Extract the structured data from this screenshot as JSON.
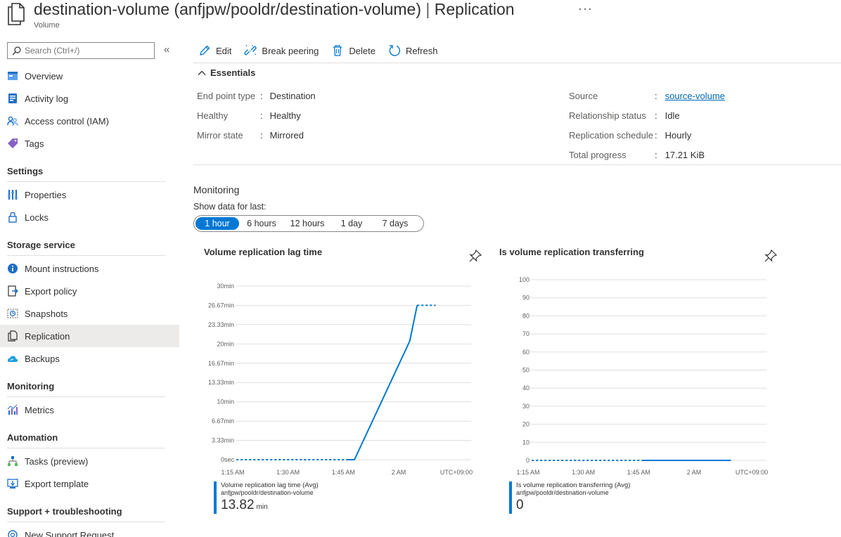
{
  "header": {
    "title": "destination-volume (anfjpw/pooldr/destination-volume)",
    "separator": "|",
    "section": "Replication",
    "more": "···",
    "subtitle": "Volume"
  },
  "sidebar": {
    "search_placeholder": "Search (Ctrl+/)",
    "collapse": "«",
    "items": [
      {
        "label": "Overview"
      },
      {
        "label": "Activity log"
      },
      {
        "label": "Access control (IAM)"
      },
      {
        "label": "Tags"
      }
    ],
    "sections": [
      {
        "title": "Settings",
        "items": [
          {
            "label": "Properties"
          },
          {
            "label": "Locks"
          }
        ]
      },
      {
        "title": "Storage service",
        "items": [
          {
            "label": "Mount instructions"
          },
          {
            "label": "Export policy"
          },
          {
            "label": "Snapshots"
          },
          {
            "label": "Replication"
          },
          {
            "label": "Backups"
          }
        ]
      },
      {
        "title": "Monitoring",
        "items": [
          {
            "label": "Metrics"
          }
        ]
      },
      {
        "title": "Automation",
        "items": [
          {
            "label": "Tasks (preview)"
          },
          {
            "label": "Export template"
          }
        ]
      },
      {
        "title": "Support + troubleshooting",
        "items": [
          {
            "label": "New Support Request"
          }
        ]
      }
    ],
    "active": "Replication"
  },
  "toolbar": {
    "edit": "Edit",
    "break_peering": "Break peering",
    "delete": "Delete",
    "refresh": "Refresh"
  },
  "essentials": {
    "title": "Essentials",
    "left": [
      {
        "key": "End point type",
        "value": "Destination"
      },
      {
        "key": "Healthy",
        "value": "Healthy"
      },
      {
        "key": "Mirror state",
        "value": "Mirrored"
      }
    ],
    "right": [
      {
        "key": "Source",
        "value": "source-volume"
      },
      {
        "key": "Relationship status",
        "value": "Idle"
      },
      {
        "key": "Replication schedule",
        "value": "Hourly"
      },
      {
        "key": "Total progress",
        "value": "17.21 KiB"
      }
    ]
  },
  "monitoring": {
    "title": "Monitoring",
    "show_label": "Show data for last:",
    "ranges": [
      "1 hour",
      "6 hours",
      "12 hours",
      "1 day",
      "7 days"
    ],
    "selected_range": "1 hour"
  },
  "chart_data": [
    {
      "type": "line",
      "title": "Volume replication lag time",
      "y_ticks": [
        "0sec",
        "3.33min",
        "6.67min",
        "10min",
        "13.33min",
        "16.67min",
        "20min",
        "23.33min",
        "26.67min",
        "30min"
      ],
      "ylim": [
        0,
        30
      ],
      "y_unit": "min",
      "x_ticks": [
        "1:15 AM",
        "1:30 AM",
        "1:45 AM",
        "2 AM",
        "UTC+09:00"
      ],
      "x": [
        "1:16 AM",
        "1:46 AM",
        "1:48 AM",
        "2:03 AM",
        "2:05 AM",
        "2:08 AM",
        "2:10 AM"
      ],
      "series": [
        {
          "values": [
            0,
            0,
            0,
            20.5,
            26.67,
            26.67,
            26.67
          ]
        }
      ],
      "grid": true,
      "legend": {
        "metric": "Volume replication lag time (Avg)",
        "resource": "anfjpw/pooldr/destination-volume",
        "value": "13.82",
        "unit": "min"
      },
      "color": "#0078d4"
    },
    {
      "type": "line",
      "title": "Is volume replication transferring",
      "y_ticks": [
        "0",
        "10",
        "20",
        "30",
        "40",
        "50",
        "60",
        "70",
        "80",
        "90",
        "100"
      ],
      "ylim": [
        0,
        100
      ],
      "x_ticks": [
        "1:15 AM",
        "1:30 AM",
        "1:45 AM",
        "2 AM",
        "UTC+09:00"
      ],
      "x": [
        "1:16 AM",
        "1:46 AM",
        "2:10 AM"
      ],
      "series": [
        {
          "values": [
            0,
            0,
            0
          ]
        }
      ],
      "grid": true,
      "legend": {
        "metric": "Is volume replication transferring (Avg)",
        "resource": "anfjpw/pooldr/destination-volume",
        "value": "0",
        "unit": ""
      },
      "color": "#0078d4"
    }
  ]
}
